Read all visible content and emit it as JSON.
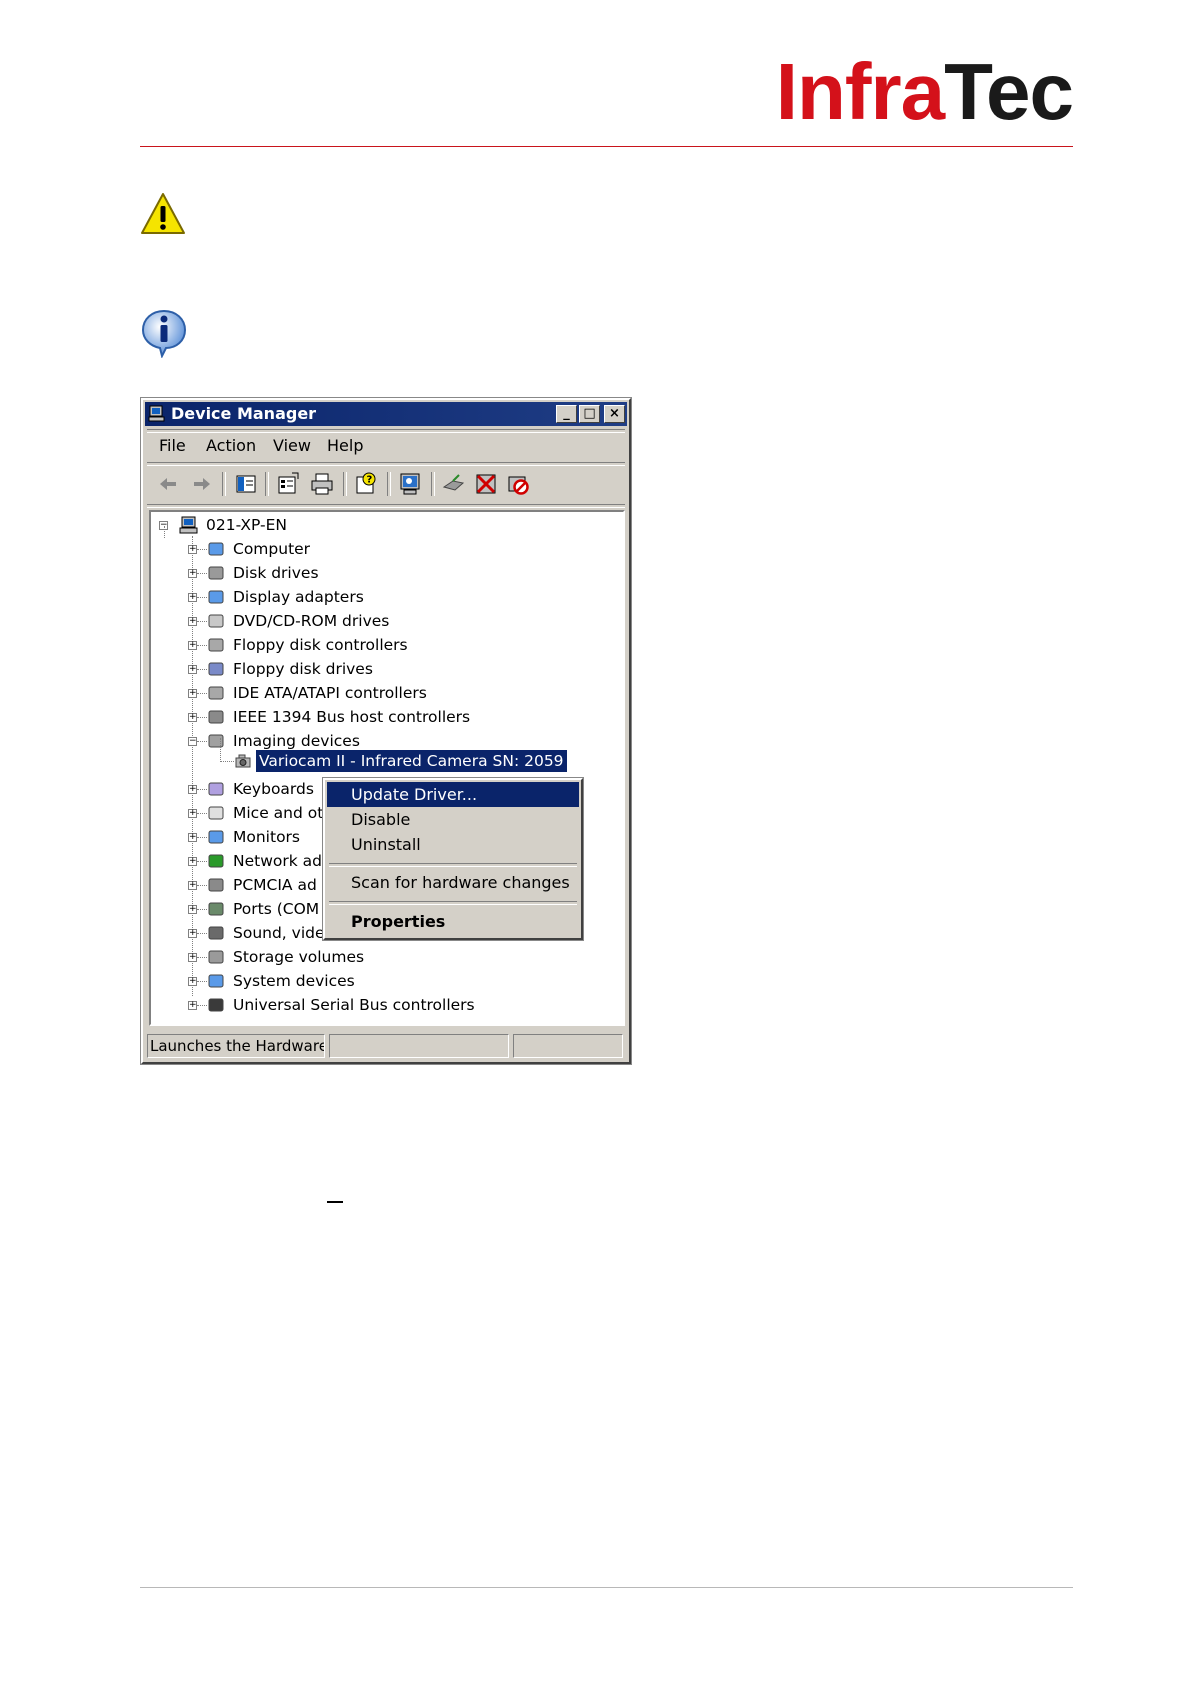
{
  "header": {
    "logo_part1": "Infra",
    "logo_part2": "Tec"
  },
  "window": {
    "title": "Device Manager",
    "controls": {
      "minimize": "_",
      "maximize": "□",
      "close": "×"
    },
    "menu": [
      "File",
      "Action",
      "View",
      "Help"
    ],
    "toolbar_icons": [
      "back-icon",
      "forward-icon",
      "show-hide-tree-icon",
      "properties-icon",
      "print-icon",
      "help-icon",
      "scan-hardware-icon",
      "update-driver-icon",
      "uninstall-icon",
      "disable-icon"
    ],
    "tree": {
      "root": "021-XP-EN",
      "categories": [
        "Computer",
        "Disk drives",
        "Display adapters",
        "DVD/CD-ROM drives",
        "Floppy disk controllers",
        "Floppy disk drives",
        "IDE ATA/ATAPI controllers",
        "IEEE 1394 Bus host controllers",
        "Imaging devices",
        "Keyboards",
        "Mice and ot",
        "Monitors",
        "Network ad",
        "PCMCIA ad",
        "Ports (COM",
        "Sound, vide",
        "Storage volumes",
        "System devices",
        "Universal Serial Bus controllers"
      ],
      "selected_device": "Variocam II - Infrared Camera  SN: 2059"
    },
    "context_menu": {
      "update_driver": "Update Driver...",
      "disable": "Disable",
      "uninstall": "Uninstall",
      "scan": "Scan for hardware changes",
      "properties": "Properties"
    },
    "status_text": "Launches the Hardware U"
  },
  "colors": {
    "brand_red": "#d4111a",
    "selection_blue": "#0a246a",
    "window_face": "#d4d0c8"
  }
}
